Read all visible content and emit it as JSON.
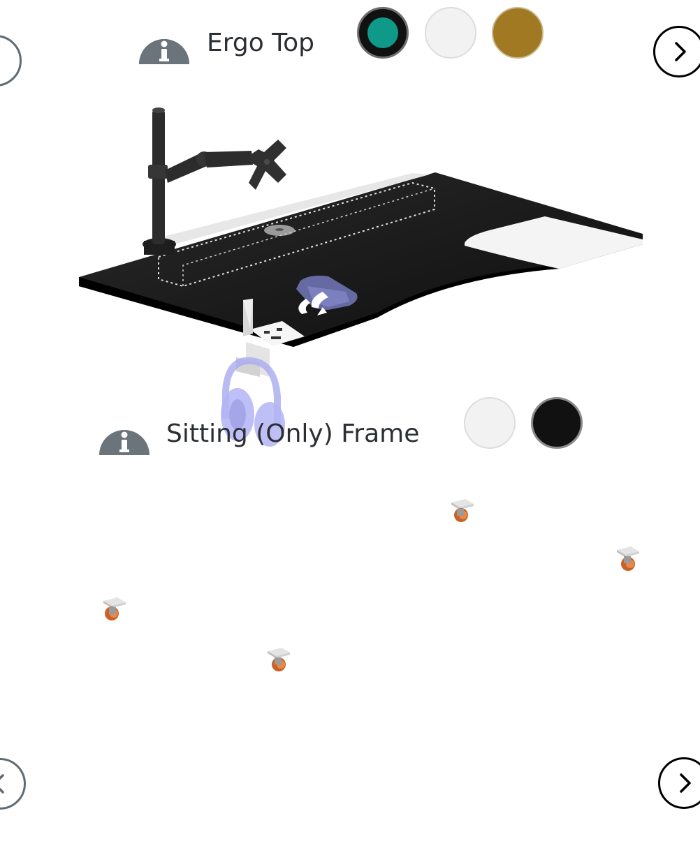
{
  "top_section": {
    "title": "Ergo Top",
    "swatches": [
      {
        "name": "teal",
        "color": "#0e9988",
        "selected": true
      },
      {
        "name": "white",
        "color": "#f2f2f2",
        "selected": false
      },
      {
        "name": "gold",
        "color": "#a07922",
        "selected": false
      }
    ]
  },
  "frame_section": {
    "title": "Sitting (Only) Frame",
    "swatches": [
      {
        "name": "white",
        "color": "#f2f2f2",
        "selected": false
      },
      {
        "name": "black",
        "color": "#111111",
        "selected": false
      }
    ]
  },
  "icons": {
    "prev": "chevron-left-icon",
    "next": "chevron-right-icon",
    "info": "info-icon"
  }
}
